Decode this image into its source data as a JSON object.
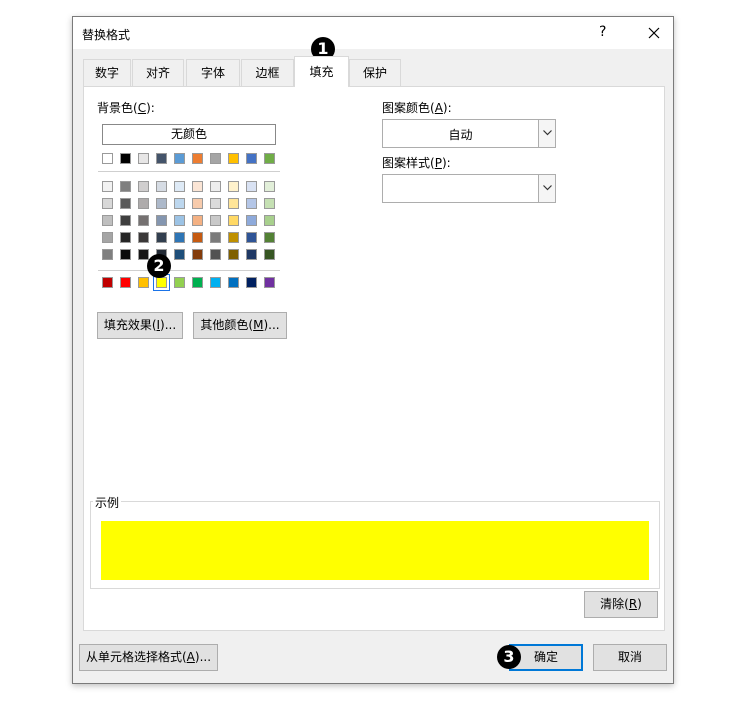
{
  "dialog": {
    "title": "替换格式",
    "help": "?",
    "tabs": [
      "数字",
      "对齐",
      "字体",
      "边框",
      "填充",
      "保护"
    ],
    "active_tab": "填充"
  },
  "fill": {
    "background_label": "背景色(",
    "background_key": "C",
    "background_suffix": "):",
    "no_color": "无颜色",
    "theme_row": [
      "#FFFFFF",
      "#000000",
      "#E7E6E6",
      "#44546A",
      "#5B9BD5",
      "#ED7D31",
      "#A5A5A5",
      "#FFC000",
      "#4472C4",
      "#70AD47"
    ],
    "tint_rows": [
      [
        "#F2F2F2",
        "#7F7F7F",
        "#D0CECE",
        "#D6DCE4",
        "#DEEAF6",
        "#FBE5D5",
        "#EDEDED",
        "#FFF2CC",
        "#D9E2F3",
        "#E2EFD9"
      ],
      [
        "#D8D8D8",
        "#595959",
        "#AEABAB",
        "#ADB9CA",
        "#BDD7EE",
        "#F7CBAC",
        "#DBDBDB",
        "#FFE598",
        "#B4C6E7",
        "#C5E0B3"
      ],
      [
        "#BFBFBF",
        "#3F3F3F",
        "#757171",
        "#8496B0",
        "#9CC3E5",
        "#F4B183",
        "#C9C9C9",
        "#FFD965",
        "#8EAADB",
        "#A8D08D"
      ],
      [
        "#A5A5A5",
        "#262626",
        "#3A3838",
        "#323F4F",
        "#2E75B5",
        "#C55A11",
        "#7B7B7B",
        "#BF9000",
        "#2F5496",
        "#538135"
      ],
      [
        "#7F7F7F",
        "#0C0C0C",
        "#171616",
        "#222A35",
        "#1E4E79",
        "#833C0B",
        "#525252",
        "#7F6000",
        "#1F3864",
        "#375623"
      ]
    ],
    "standard_row": [
      "#C00000",
      "#FF0000",
      "#FFC000",
      "#FFFF00",
      "#92D050",
      "#00B050",
      "#00B0F0",
      "#0070C0",
      "#002060",
      "#7030A0"
    ],
    "selected_standard_index": 3,
    "fill_effects_button": "填充效果(",
    "fill_effects_key": "I",
    "fill_effects_suffix": ")...",
    "more_colors_button": "其他颜色(",
    "more_colors_key": "M",
    "more_colors_suffix": ")...",
    "pattern_color_label": "图案颜色(",
    "pattern_color_key": "A",
    "pattern_color_suffix": "):",
    "pattern_color_value": "自动",
    "pattern_style_label": "图案样式(",
    "pattern_style_key": "P",
    "pattern_style_suffix": "):",
    "pattern_style_value": "",
    "sample_label": "示例",
    "sample_color": "#FFFF00",
    "clear_button": "清除(",
    "clear_key": "R",
    "clear_suffix": ")"
  },
  "footer": {
    "choose_format_button": "从单元格选择格式(",
    "choose_format_key": "A",
    "choose_format_suffix": ")...",
    "ok_button": "确定",
    "cancel_button": "取消"
  },
  "steps": [
    "1",
    "2",
    "3"
  ]
}
